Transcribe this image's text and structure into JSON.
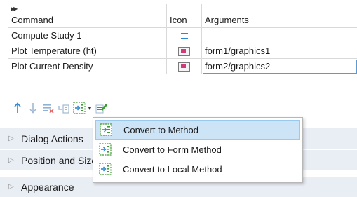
{
  "table": {
    "headers": {
      "command": "Command",
      "icon": "Icon",
      "arguments": "Arguments"
    },
    "rows": [
      {
        "command": "Compute Study 1",
        "icon": "run-icon",
        "arguments": ""
      },
      {
        "command": "Plot Temperature (ht)",
        "icon": "plot-icon",
        "arguments": "form1/graphics1"
      },
      {
        "command": "Plot Current Density",
        "icon": "plot-icon",
        "arguments": "form2/graphics2"
      }
    ]
  },
  "toolbar": {
    "buttons": [
      "move-up-icon",
      "move-down-icon",
      "delete-icon",
      "move-to-icon",
      "convert-icon",
      "edit-icon"
    ]
  },
  "sections": [
    {
      "label": "Dialog Actions"
    },
    {
      "label": "Position and Size"
    },
    {
      "label": "Appearance"
    }
  ],
  "menu": {
    "items": [
      {
        "label": "Convert to Method",
        "icon": "convert-method-icon",
        "highlighted": true
      },
      {
        "label": "Convert to Form Method",
        "icon": "convert-form-method-icon",
        "highlighted": false
      },
      {
        "label": "Convert to Local Method",
        "icon": "convert-local-method-icon",
        "highlighted": false
      }
    ]
  },
  "colors": {
    "section_bg": "#e9eef5",
    "menu_highlight": "#cde4f7",
    "accent_blue": "#2a87d0",
    "icon_green": "#3f9c35"
  }
}
